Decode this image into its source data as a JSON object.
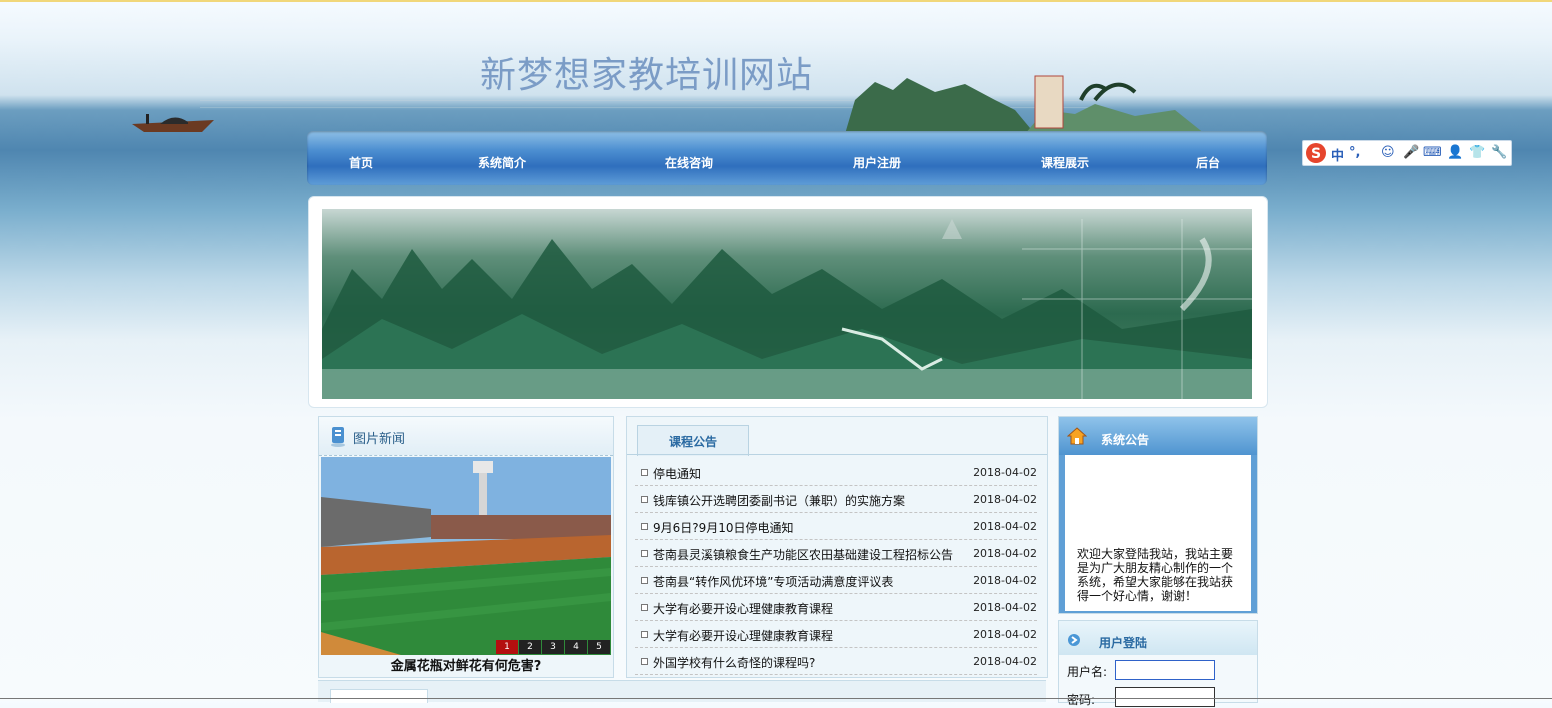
{
  "header": {
    "site_title": "新梦想家教培训网站"
  },
  "nav": {
    "items": [
      {
        "label": "首页"
      },
      {
        "label": "系统简介"
      },
      {
        "label": "在线咨询"
      },
      {
        "label": "用户注册"
      },
      {
        "label": "课程展示"
      },
      {
        "label": "后台"
      }
    ]
  },
  "ime": {
    "mode": "中",
    "punct": "°,",
    "icons": [
      "sogou-logo-icon",
      "smiley-icon",
      "mic-icon",
      "keyboard-icon",
      "user-icon",
      "shirt-icon",
      "wrench-icon"
    ]
  },
  "photo_news": {
    "title": "图片新闻",
    "caption": "金属花瓶对鲜花有何危害?",
    "pager": [
      "1",
      "2",
      "3",
      "4",
      "5"
    ],
    "active_page": "1"
  },
  "course_notice": {
    "tab_label": "课程公告",
    "items": [
      {
        "title": "停电通知",
        "date": "2018-04-02"
      },
      {
        "title": "钱库镇公开选聘团委副书记（兼职）的实施方案",
        "date": "2018-04-02"
      },
      {
        "title": "9月6日?9月10日停电通知",
        "date": "2018-04-02"
      },
      {
        "title": "苍南县灵溪镇粮食生产功能区农田基础建设工程招标公告",
        "date": "2018-04-02"
      },
      {
        "title": "苍南县“转作风优环境”专项活动满意度评议表",
        "date": "2018-04-02"
      },
      {
        "title": "大学有必要开设心理健康教育课程",
        "date": "2018-04-02"
      },
      {
        "title": "大学有必要开设心理健康教育课程",
        "date": "2018-04-02"
      },
      {
        "title": "外国学校有什么奇怪的课程吗?",
        "date": "2018-04-02"
      }
    ]
  },
  "system_notice": {
    "title": "系统公告",
    "text": "欢迎大家登陆我站，我站主要是为广大朋友精心制作的一个系统，希望大家能够在我站获得一个好心情，谢谢！"
  },
  "login": {
    "title": "用户登陆",
    "username_label": "用户名:",
    "password_label": "密码:",
    "username_value": "",
    "password_value": ""
  },
  "colors": {
    "nav_blue": "#2f6fbd",
    "title_blue": "#7b9cc6",
    "pager_active": "#b40f0f"
  }
}
